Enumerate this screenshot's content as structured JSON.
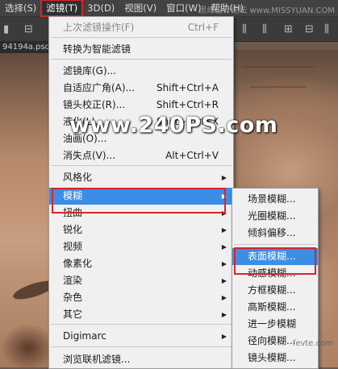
{
  "menubar": {
    "items": [
      "选择(S)",
      "滤镜(T)",
      "3D(D)",
      "视图(V)",
      "窗口(W)",
      "帮助(H)"
    ],
    "active_index": 1
  },
  "watermark_top": "思缘设计论坛 www.MISSYUAN.COM",
  "document_tab": "94194a.psd",
  "overlay_text": "www.240PS.com",
  "filter_menu": {
    "items": [
      {
        "label": "上次滤镜操作(F)",
        "shortcut": "Ctrl+F",
        "disabled": true
      },
      {
        "label": "转换为智能滤镜",
        "shortcut": ""
      },
      {
        "label": "滤镜库(G)...",
        "shortcut": ""
      },
      {
        "label": "自适应广角(A)...",
        "shortcut": "Shift+Ctrl+A"
      },
      {
        "label": "镜头校正(R)...",
        "shortcut": "Shift+Ctrl+R"
      },
      {
        "label": "液化(L)...",
        "shortcut": "Shift+Ctrl+X"
      },
      {
        "label": "油画(O)...",
        "shortcut": ""
      },
      {
        "label": "消失点(V)...",
        "shortcut": "Alt+Ctrl+V"
      },
      {
        "label": "风格化",
        "submenu": true
      },
      {
        "label": "模糊",
        "submenu": true,
        "highlighted": true
      },
      {
        "label": "扭曲",
        "submenu": true
      },
      {
        "label": "锐化",
        "submenu": true
      },
      {
        "label": "视频",
        "submenu": true
      },
      {
        "label": "像素化",
        "submenu": true
      },
      {
        "label": "渲染",
        "submenu": true
      },
      {
        "label": "杂色",
        "submenu": true
      },
      {
        "label": "其它",
        "submenu": true
      },
      {
        "label": "Digimarc",
        "submenu": true
      },
      {
        "label": "浏览联机滤镜...",
        "shortcut": ""
      }
    ]
  },
  "blur_submenu": {
    "items": [
      {
        "label": "场景模糊..."
      },
      {
        "label": "光圈模糊..."
      },
      {
        "label": "倾斜偏移..."
      },
      {
        "label": "表面模糊...",
        "highlighted": true
      },
      {
        "label": "动感模糊..."
      },
      {
        "label": "方框模糊..."
      },
      {
        "label": "高斯模糊..."
      },
      {
        "label": "进一步模糊"
      },
      {
        "label": "径向模糊..."
      },
      {
        "label": "镜头模糊..."
      }
    ]
  },
  "corner_watermark": "fevte.com",
  "colors": {
    "highlight": "#3b8de6",
    "annotation": "#d8242b",
    "menu_bg": "#f0f0f0"
  }
}
